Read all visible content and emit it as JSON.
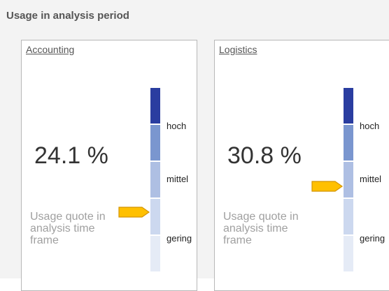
{
  "panel": {
    "title": "Usage in analysis period"
  },
  "cards": [
    {
      "title": "Accounting",
      "value": "24.1 %",
      "caption": "Usage quote in analysis time frame",
      "indicator_level": "gering"
    },
    {
      "title": "Logistics",
      "value": "30.8 %",
      "caption": "Usage quote in analysis time frame",
      "indicator_level": "mittel"
    }
  ],
  "scale": {
    "labels": {
      "high": "hoch",
      "medium": "mittel",
      "low": "gering"
    },
    "segment_colors": [
      "#2a3da0",
      "#7a96cf",
      "#aebfe3",
      "#ccd8ef",
      "#e5ebf6"
    ]
  },
  "colors": {
    "marker_fill": "#ffc000",
    "marker_stroke": "#d49500"
  }
}
